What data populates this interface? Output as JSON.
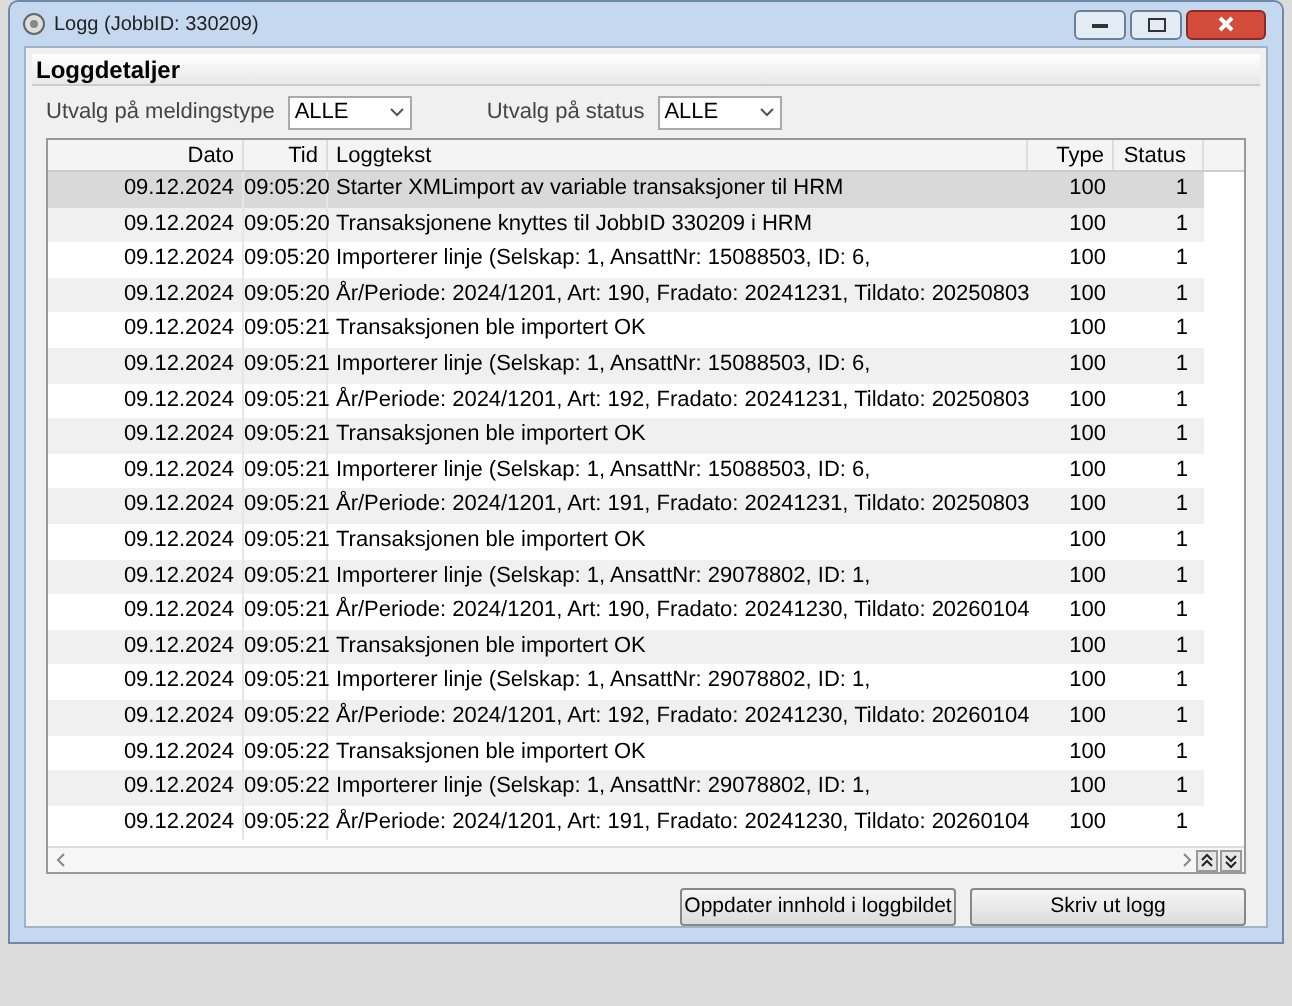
{
  "window": {
    "title": "Logg (JobbID: 330209)"
  },
  "panel": {
    "title": "Loggdetaljer"
  },
  "filters": [
    {
      "label": "Utvalg på meldingstype",
      "value": "ALLE"
    },
    {
      "label": "Utvalg på status",
      "value": "ALLE"
    }
  ],
  "table": {
    "columns": [
      "Dato",
      "Tid",
      "Loggtekst",
      "Type",
      "Status"
    ],
    "rows": [
      {
        "date": "09.12.2024",
        "time": "09:05:20",
        "text": "Starter XMLimport av variable transaksjoner til HRM",
        "type": "100",
        "status": "1",
        "selected": true
      },
      {
        "date": "09.12.2024",
        "time": "09:05:20",
        "text": "Transaksjonene knyttes til JobbID 330209 i HRM",
        "type": "100",
        "status": "1",
        "selected": false
      },
      {
        "date": "09.12.2024",
        "time": "09:05:20",
        "text": "Importerer linje (Selskap: 1, AnsattNr: 15088503, ID: 6,",
        "type": "100",
        "status": "1",
        "selected": false
      },
      {
        "date": "09.12.2024",
        "time": "09:05:20",
        "text": "År/Periode: 2024/1201, Art: 190, Fradato: 20241231, Tildato: 20250803",
        "type": "100",
        "status": "1",
        "selected": false
      },
      {
        "date": "09.12.2024",
        "time": "09:05:21",
        "text": "Transaksjonen ble importert OK",
        "type": "100",
        "status": "1",
        "selected": false
      },
      {
        "date": "09.12.2024",
        "time": "09:05:21",
        "text": "Importerer linje (Selskap: 1, AnsattNr: 15088503, ID: 6,",
        "type": "100",
        "status": "1",
        "selected": false
      },
      {
        "date": "09.12.2024",
        "time": "09:05:21",
        "text": "År/Periode: 2024/1201, Art: 192, Fradato: 20241231, Tildato: 20250803",
        "type": "100",
        "status": "1",
        "selected": false
      },
      {
        "date": "09.12.2024",
        "time": "09:05:21",
        "text": "Transaksjonen ble importert OK",
        "type": "100",
        "status": "1",
        "selected": false
      },
      {
        "date": "09.12.2024",
        "time": "09:05:21",
        "text": "Importerer linje (Selskap: 1, AnsattNr: 15088503, ID: 6,",
        "type": "100",
        "status": "1",
        "selected": false
      },
      {
        "date": "09.12.2024",
        "time": "09:05:21",
        "text": "År/Periode: 2024/1201, Art: 191, Fradato: 20241231, Tildato: 20250803",
        "type": "100",
        "status": "1",
        "selected": false
      },
      {
        "date": "09.12.2024",
        "time": "09:05:21",
        "text": "Transaksjonen ble importert OK",
        "type": "100",
        "status": "1",
        "selected": false
      },
      {
        "date": "09.12.2024",
        "time": "09:05:21",
        "text": "Importerer linje (Selskap: 1, AnsattNr: 29078802, ID: 1,",
        "type": "100",
        "status": "1",
        "selected": false
      },
      {
        "date": "09.12.2024",
        "time": "09:05:21",
        "text": "År/Periode: 2024/1201, Art: 190, Fradato: 20241230, Tildato: 20260104",
        "type": "100",
        "status": "1",
        "selected": false
      },
      {
        "date": "09.12.2024",
        "time": "09:05:21",
        "text": "Transaksjonen ble importert OK",
        "type": "100",
        "status": "1",
        "selected": false
      },
      {
        "date": "09.12.2024",
        "time": "09:05:21",
        "text": "Importerer linje (Selskap: 1, AnsattNr: 29078802, ID: 1,",
        "type": "100",
        "status": "1",
        "selected": false
      },
      {
        "date": "09.12.2024",
        "time": "09:05:22",
        "text": "År/Periode: 2024/1201, Art: 192, Fradato: 20241230, Tildato: 20260104",
        "type": "100",
        "status": "1",
        "selected": false
      },
      {
        "date": "09.12.2024",
        "time": "09:05:22",
        "text": "Transaksjonen ble importert OK",
        "type": "100",
        "status": "1",
        "selected": false
      },
      {
        "date": "09.12.2024",
        "time": "09:05:22",
        "text": "Importerer linje (Selskap: 1, AnsattNr: 29078802, ID: 1,",
        "type": "100",
        "status": "1",
        "selected": false
      },
      {
        "date": "09.12.2024",
        "time": "09:05:22",
        "text": "År/Periode: 2024/1201, Art: 191, Fradato: 20241230, Tildato: 20260104",
        "type": "100",
        "status": "1",
        "selected": false
      }
    ]
  },
  "buttons": [
    "Oppdater innhold i loggbildet",
    "Skriv ut logg"
  ]
}
